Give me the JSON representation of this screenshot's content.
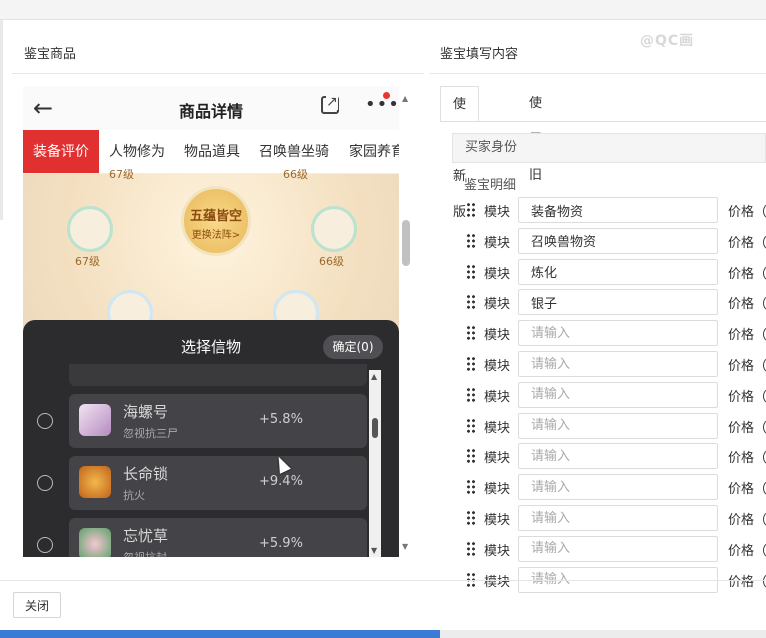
{
  "left_section": {
    "title": "鉴宝商品"
  },
  "right_section": {
    "title": "鉴宝填写内容"
  },
  "watermark": "@QC画",
  "phone": {
    "back_icon": "arrow-left-icon",
    "title": "商品详情",
    "tabs": [
      "装备评价",
      "人物修为",
      "物品道具",
      "召唤兽坐骑",
      "家园养育"
    ],
    "active_tab": "装备评价",
    "center_button": {
      "line1": "五蕴皆空",
      "line2": "更换法阵>"
    },
    "levels": [
      "67级",
      "66级"
    ],
    "top_levels": [
      "67级",
      "66级"
    ],
    "panel": {
      "title": "选择信物",
      "confirm_label": "确定(0)",
      "options": [
        {
          "name": "海螺号",
          "desc": "忽视抗三尸",
          "pct": "+5.8%"
        },
        {
          "name": "长命锁",
          "desc": "抗火",
          "pct": "+9.4%"
        },
        {
          "name": "忘忧草",
          "desc": "忽视抗封",
          "pct": "+5.9%"
        }
      ]
    }
  },
  "form": {
    "tabs": [
      "使用新版",
      "使用旧版"
    ],
    "active_tab": "使用新版",
    "buyer_label": "买家身份",
    "detail_label": "鉴宝明细",
    "row_label": "模块",
    "price_label": "价格（",
    "placeholder": "请输入",
    "rows": [
      {
        "value": "装备物资"
      },
      {
        "value": "召唤兽物资"
      },
      {
        "value": "炼化"
      },
      {
        "value": "银子"
      },
      {
        "value": ""
      },
      {
        "value": ""
      },
      {
        "value": ""
      },
      {
        "value": ""
      },
      {
        "value": ""
      },
      {
        "value": ""
      },
      {
        "value": ""
      },
      {
        "value": ""
      },
      {
        "value": ""
      }
    ]
  },
  "footer": {
    "close_label": "关闭"
  }
}
